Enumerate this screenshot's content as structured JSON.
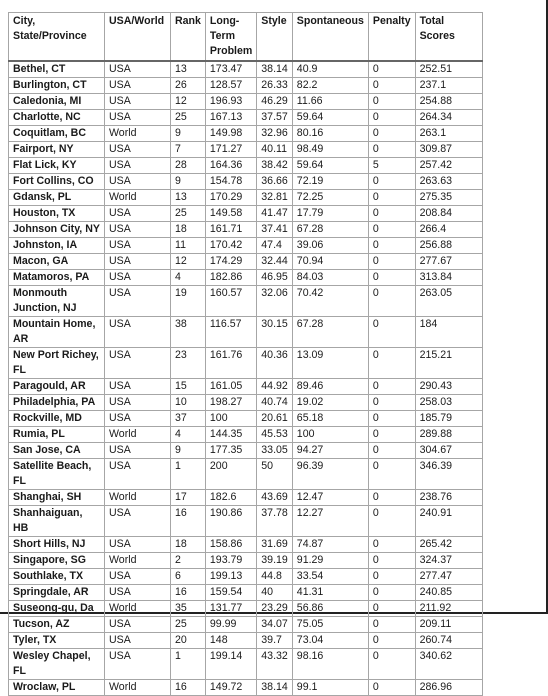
{
  "table": {
    "columns": [
      "City, State/Province",
      "USA/World",
      "Rank",
      "Long-Term Problem",
      "Style",
      "Spontaneous",
      "Penalty",
      "Total Scores"
    ],
    "rows": [
      [
        "Bethel, CT",
        "USA",
        "13",
        "173.47",
        "38.14",
        "40.9",
        "0",
        "252.51"
      ],
      [
        "Burlington, CT",
        "USA",
        "26",
        "128.57",
        "26.33",
        "82.2",
        "0",
        "237.1"
      ],
      [
        "Caledonia, MI",
        "USA",
        "12",
        "196.93",
        "46.29",
        "11.66",
        "0",
        "254.88"
      ],
      [
        "Charlotte, NC",
        "USA",
        "25",
        "167.13",
        "37.57",
        "59.64",
        "0",
        "264.34"
      ],
      [
        "Coquitlam, BC",
        "World",
        "9",
        "149.98",
        "32.96",
        "80.16",
        "0",
        "263.1"
      ],
      [
        "Fairport, NY",
        "USA",
        "7",
        "171.27",
        "40.11",
        "98.49",
        "0",
        "309.87"
      ],
      [
        "Flat Lick, KY",
        "USA",
        "28",
        "164.36",
        "38.42",
        "59.64",
        "5",
        "257.42"
      ],
      [
        "Fort Collins, CO",
        "USA",
        "9",
        "154.78",
        "36.66",
        "72.19",
        "0",
        "263.63"
      ],
      [
        "Gdansk, PL",
        "World",
        "13",
        "170.29",
        "32.81",
        "72.25",
        "0",
        "275.35"
      ],
      [
        "Houston, TX",
        "USA",
        "25",
        "149.58",
        "41.47",
        "17.79",
        "0",
        "208.84"
      ],
      [
        "Johnson City, NY",
        "USA",
        "18",
        "161.71",
        "37.41",
        "67.28",
        "0",
        "266.4"
      ],
      [
        "Johnston, IA",
        "USA",
        "11",
        "170.42",
        "47.4",
        "39.06",
        "0",
        "256.88"
      ],
      [
        "Macon, GA",
        "USA",
        "12",
        "174.29",
        "32.44",
        "70.94",
        "0",
        "277.67"
      ],
      [
        "Matamoros, PA",
        "USA",
        "4",
        "182.86",
        "46.95",
        "84.03",
        "0",
        "313.84"
      ],
      [
        "Monmouth Junction, NJ",
        "USA",
        "19",
        "160.57",
        "32.06",
        "70.42",
        "0",
        "263.05"
      ],
      [
        "Mountain Home, AR",
        "USA",
        "38",
        "116.57",
        "30.15",
        "67.28",
        "0",
        "184"
      ],
      [
        "New Port Richey, FL",
        "USA",
        "23",
        "161.76",
        "40.36",
        "13.09",
        "0",
        "215.21"
      ],
      [
        "Paragould, AR",
        "USA",
        "15",
        "161.05",
        "44.92",
        "89.46",
        "0",
        "290.43"
      ],
      [
        "Philadelphia, PA",
        "USA",
        "10",
        "198.27",
        "40.74",
        "19.02",
        "0",
        "258.03"
      ],
      [
        "Rockville, MD",
        "USA",
        "37",
        "100",
        "20.61",
        "65.18",
        "0",
        "185.79"
      ],
      [
        "Rumia, PL",
        "World",
        "4",
        "144.35",
        "45.53",
        "100",
        "0",
        "289.88"
      ],
      [
        "San Jose, CA",
        "USA",
        "9",
        "177.35",
        "33.05",
        "94.27",
        "0",
        "304.67"
      ],
      [
        "Satellite Beach, FL",
        "USA",
        "1",
        "200",
        "50",
        "96.39",
        "0",
        "346.39"
      ],
      [
        "Shanghai, SH",
        "World",
        "17",
        "182.6",
        "43.69",
        "12.47",
        "0",
        "238.76"
      ],
      [
        "Shanhaiguan, HB",
        "USA",
        "16",
        "190.86",
        "37.78",
        "12.27",
        "0",
        "240.91"
      ],
      [
        "Short Hills, NJ",
        "USA",
        "18",
        "158.86",
        "31.69",
        "74.87",
        "0",
        "265.42"
      ],
      [
        "Singapore, SG",
        "World",
        "2",
        "193.79",
        "39.19",
        "91.29",
        "0",
        "324.37"
      ],
      [
        "Southlake, TX",
        "USA",
        "6",
        "199.13",
        "44.8",
        "33.54",
        "0",
        "277.47"
      ],
      [
        "Springdale, AR",
        "USA",
        "16",
        "159.54",
        "40",
        "41.31",
        "0",
        "240.85"
      ],
      [
        "Suseong-gu, Da",
        "World",
        "35",
        "131.77",
        "23.29",
        "56.86",
        "0",
        "211.92"
      ],
      [
        "Tucson, AZ",
        "USA",
        "25",
        "99.99",
        "34.07",
        "75.05",
        "0",
        "209.11"
      ],
      [
        "Tyler, TX",
        "USA",
        "20",
        "148",
        "39.7",
        "73.04",
        "0",
        "260.74"
      ],
      [
        "Wesley Chapel, FL",
        "USA",
        "1",
        "199.14",
        "43.32",
        "98.16",
        "0",
        "340.62"
      ],
      [
        "Wroclaw, PL",
        "World",
        "16",
        "149.72",
        "38.14",
        "99.1",
        "0",
        "286.96"
      ]
    ]
  }
}
